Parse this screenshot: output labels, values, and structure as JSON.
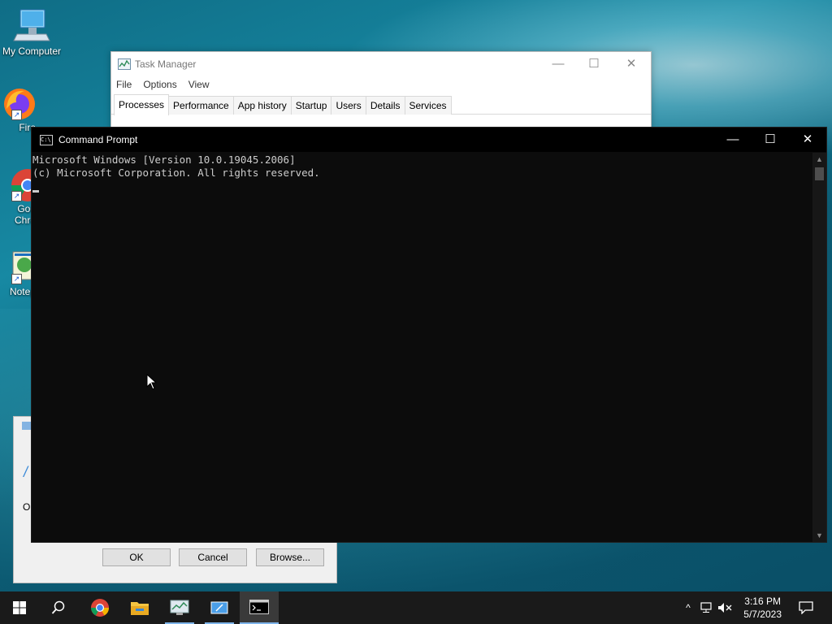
{
  "desktop": {
    "icons": [
      {
        "label": "My Computer"
      },
      {
        "label": "Fire"
      },
      {
        "label": "Goo Chro"
      },
      {
        "label": "Notep"
      }
    ]
  },
  "dialog": {
    "partial_text": "O",
    "ok_label": "OK",
    "cancel_label": "Cancel",
    "browse_label": "Browse..."
  },
  "task_manager": {
    "title": "Task Manager",
    "menu": [
      "File",
      "Options",
      "View"
    ],
    "tabs": [
      "Processes",
      "Performance",
      "App history",
      "Startup",
      "Users",
      "Details",
      "Services"
    ],
    "active_tab": "Processes"
  },
  "cmd": {
    "title": "Command Prompt",
    "lines": [
      "Microsoft Windows [Version 10.0.19045.2006]",
      "(c) Microsoft Corporation. All rights reserved."
    ]
  },
  "taskbar": {
    "clock_time": "3:16 PM",
    "clock_date": "5/7/2023"
  },
  "colors": {
    "console_bg": "#0c0c0c",
    "console_text": "#cccccc",
    "taskbar_bg": "#1a1a1a",
    "accent": "#7eb4ea"
  }
}
